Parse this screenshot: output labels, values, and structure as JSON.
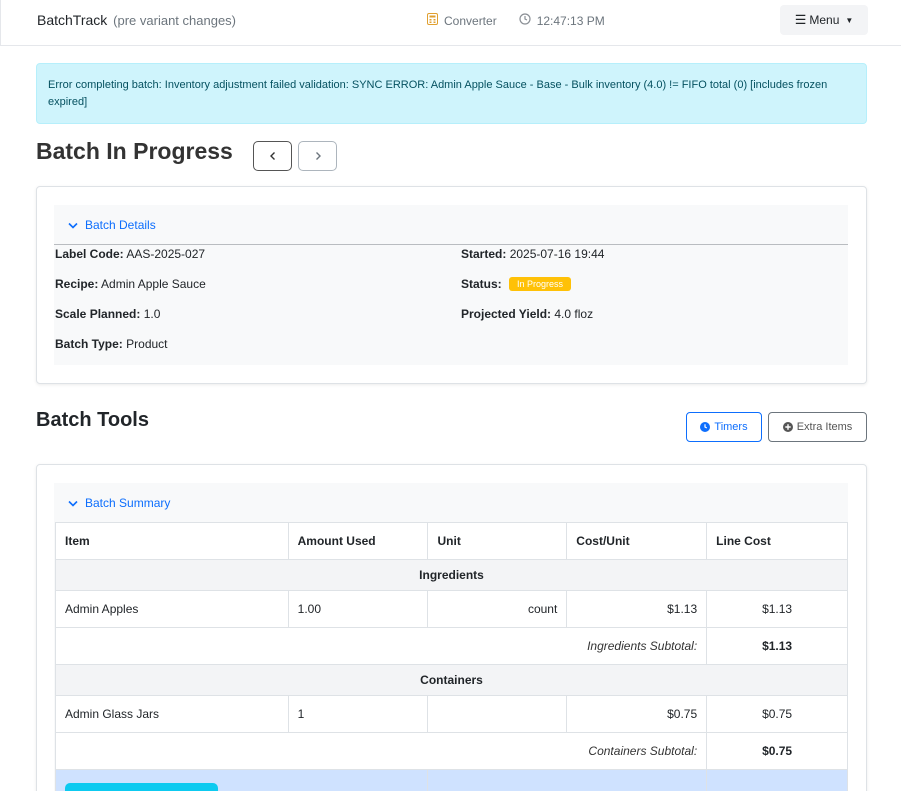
{
  "navbar": {
    "brand": "BatchTrack",
    "brand_sub": "(pre variant changes)",
    "converter_label": "Converter",
    "clock_time": "12:47:13 PM",
    "menu_label": "Menu"
  },
  "alert": {
    "message": "Error completing batch: Inventory adjustment failed validation: SYNC ERROR: Admin Apple Sauce - Base - Bulk inventory (4.0) != FIFO total (0) [includes frozen expired]"
  },
  "page": {
    "title": "Batch In Progress"
  },
  "details": {
    "header": "Batch Details",
    "label_code_key": "Label Code:",
    "label_code": "AAS-2025-027",
    "recipe_key": "Recipe:",
    "recipe": "Admin Apple Sauce",
    "scale_key": "Scale Planned:",
    "scale": "1.0",
    "type_key": "Batch Type:",
    "type": "Product",
    "started_key": "Started:",
    "started": "2025-07-16 19:44",
    "status_key": "Status:",
    "status": "In Progress",
    "yield_key": "Projected Yield:",
    "yield": "4.0 floz"
  },
  "tools": {
    "title": "Batch Tools",
    "timers_label": "Timers",
    "extras_label": "Extra Items"
  },
  "summary": {
    "header": "Batch Summary",
    "columns": [
      "Item",
      "Amount Used",
      "Unit",
      "Cost/Unit",
      "Line Cost"
    ],
    "ingredients_group": "Ingredients",
    "ingredients": [
      {
        "item": "Admin Apples",
        "amount": "1.00",
        "unit": "count",
        "cost_unit": "$1.13",
        "line_cost": "$1.13"
      }
    ],
    "ingredients_subtotal_label": "Ingredients Subtotal:",
    "ingredients_subtotal": "$1.13",
    "containers_group": "Containers",
    "containers": [
      {
        "item": "Admin Glass Jars",
        "amount": "1",
        "unit": "",
        "cost_unit": "$0.75",
        "line_cost": "$0.75"
      }
    ],
    "containers_subtotal_label": "Containers Subtotal:",
    "containers_subtotal": "$0.75"
  },
  "colors": {
    "primary": "#0d6efd",
    "alert_bg": "#cff4fc",
    "status_badge": "#ffc107",
    "info_button": "#0dcaf0"
  }
}
